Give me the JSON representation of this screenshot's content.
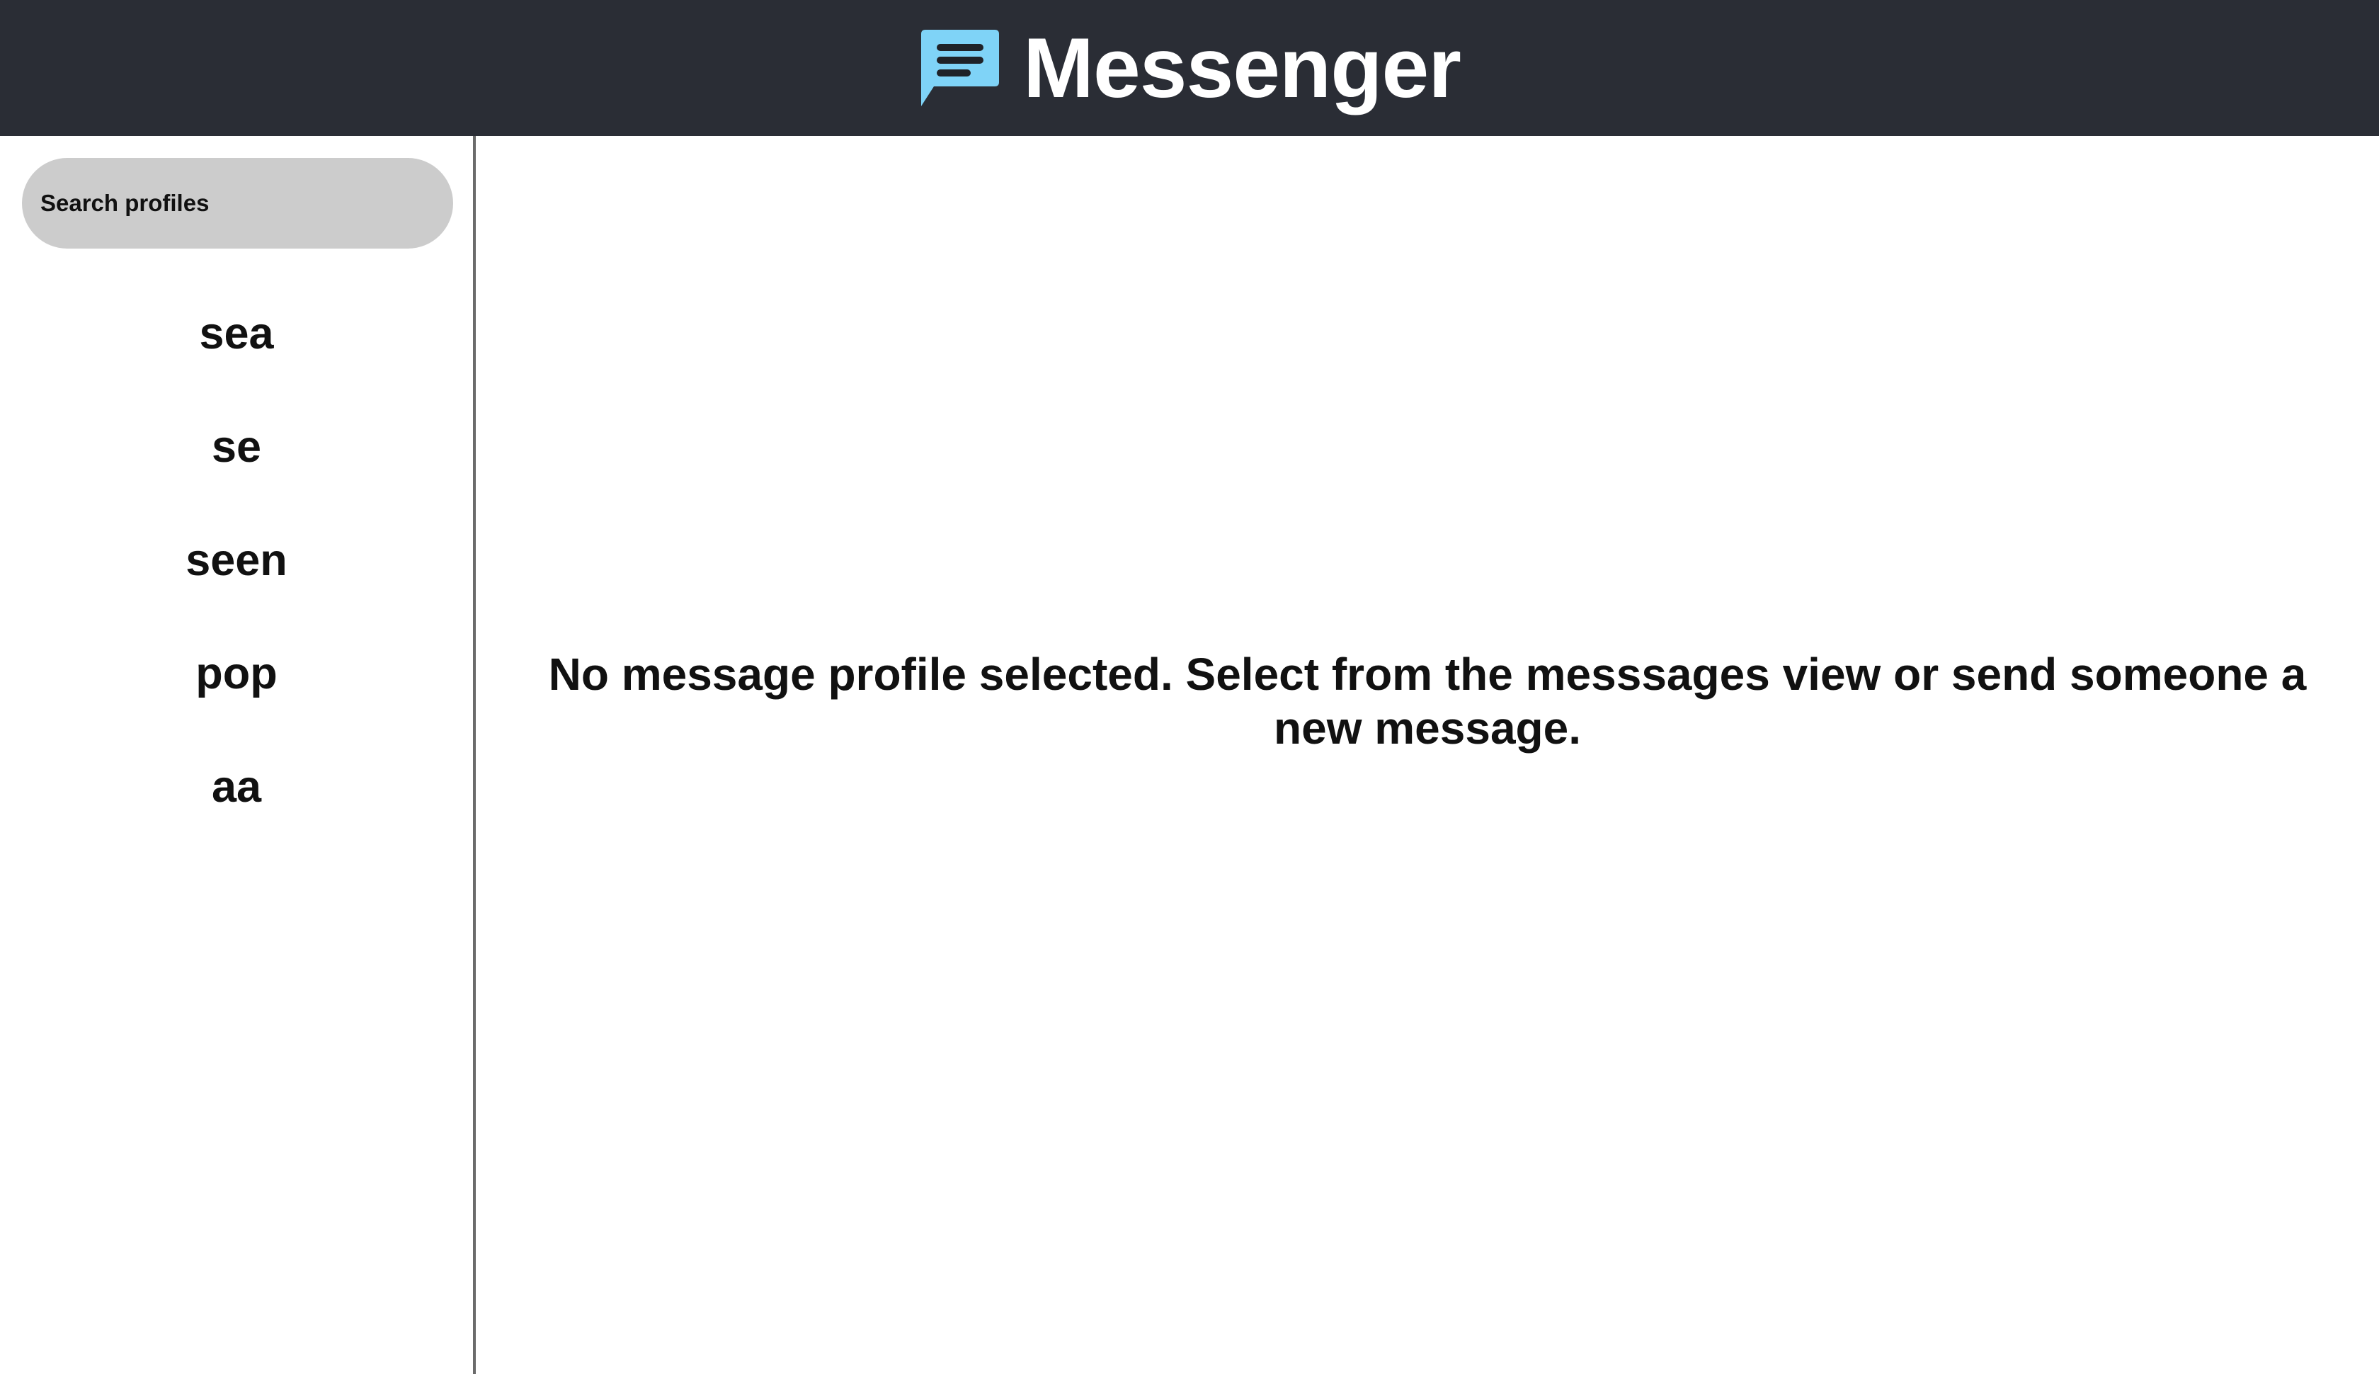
{
  "header": {
    "title": "Messenger",
    "logo_icon": "chat-bubble-icon",
    "logo_color": "#7fd3f7",
    "background_color": "#2a2d35"
  },
  "sidebar": {
    "search": {
      "placeholder": "Search profiles",
      "value": ""
    },
    "profiles": [
      {
        "name": "sea"
      },
      {
        "name": "se"
      },
      {
        "name": "seen"
      },
      {
        "name": "pop"
      },
      {
        "name": "aa"
      }
    ]
  },
  "main": {
    "empty_message": "No message profile selected. Select from the messsages view or send someone a new message."
  }
}
